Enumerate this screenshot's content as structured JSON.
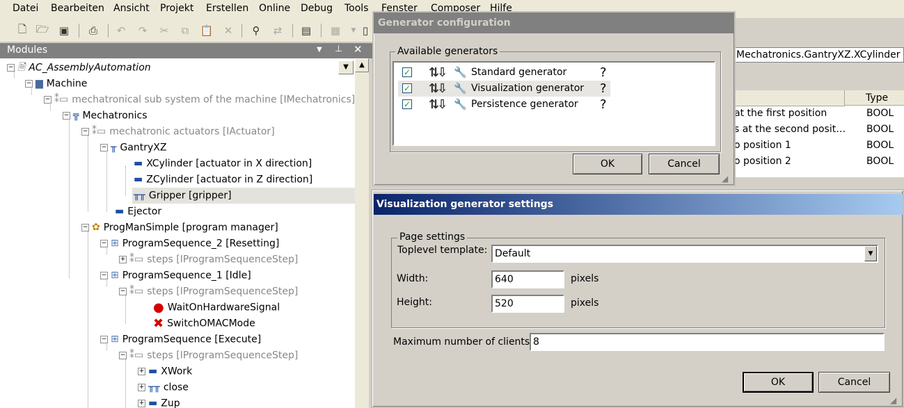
{
  "menu": [
    "Datei",
    "Bearbeiten",
    "Ansicht",
    "Projekt",
    "Erstellen",
    "Online",
    "Debug",
    "Tools",
    "Fenster",
    "Composer",
    "Hilfe"
  ],
  "toolbar": {
    "icons": [
      "new-file",
      "open-folder",
      "save",
      "print",
      "undo",
      "redo",
      "cut",
      "copy",
      "paste",
      "delete",
      "find",
      "find-replace",
      "clipboard",
      "table",
      "page"
    ]
  },
  "modules": {
    "title": "Modules",
    "tree": [
      {
        "label": "AC_AssemblyAutomation",
        "style": "italic"
      },
      {
        "label": "Machine"
      },
      {
        "label": "mechatronical sub system of the machine [IMechatronics]",
        "style": "gray"
      },
      {
        "label": "Mechatronics"
      },
      {
        "label": "mechatronic actuators [IActuator]",
        "style": "gray"
      },
      {
        "label": "GantryXZ"
      },
      {
        "label": "XCylinder [actuator in X direction]"
      },
      {
        "label": "ZCylinder [actuator in Z direction]"
      },
      {
        "label": "Gripper [gripper]",
        "selected": true
      },
      {
        "label": "Ejector"
      },
      {
        "label": "ProgManSimple [program manager]"
      },
      {
        "label": "ProgramSequence_2 [Resetting]"
      },
      {
        "label": "steps [IProgramSequenceStep]",
        "style": "gray"
      },
      {
        "label": "ProgramSequence_1 [Idle]"
      },
      {
        "label": "steps [IProgramSequenceStep]",
        "style": "gray"
      },
      {
        "label": "WaitOnHardwareSignal"
      },
      {
        "label": "SwitchOMACMode"
      },
      {
        "label": "ProgramSequence [Execute]"
      },
      {
        "label": "steps [IProgramSequenceStep]",
        "style": "gray"
      },
      {
        "label": "XWork"
      },
      {
        "label": "close"
      },
      {
        "label": "Zup"
      }
    ]
  },
  "background_panel": {
    "path": "Mechatronics.GantryXZ.XCylinder",
    "type_header": "Type",
    "rows": [
      {
        "desc": "at the first position",
        "type": "BOOL"
      },
      {
        "desc": "s at the second posit…",
        "type": "BOOL"
      },
      {
        "desc": "o position 1",
        "type": "BOOL"
      },
      {
        "desc": "o position 2",
        "type": "BOOL"
      }
    ]
  },
  "generator_dialog": {
    "title": "Generator configuration",
    "group_label": "Available generators",
    "generators": [
      {
        "name": "Standard generator",
        "checked": true,
        "help": "?"
      },
      {
        "name": "Visualization generator",
        "checked": true,
        "help": "?"
      },
      {
        "name": "Persistence generator",
        "checked": true,
        "help": "?"
      }
    ],
    "ok_label": "OK",
    "cancel_label": "Cancel"
  },
  "visualization_dialog": {
    "title": "Visualization generator settings",
    "page_group_label": "Page settings",
    "template_label": "Toplevel template:",
    "template_value": "Default",
    "width_label": "Width:",
    "width_value": "640",
    "width_unit": "pixels",
    "height_label": "Height:",
    "height_value": "520",
    "height_unit": "pixels",
    "clients_label": "Maximum number of clients:",
    "clients_value": "8",
    "ok_label": "OK",
    "cancel_label": "Cancel"
  },
  "colors": {
    "title_active_start": "#0a246a",
    "title_active_end": "#a6caf0",
    "title_inactive": "#808080"
  }
}
